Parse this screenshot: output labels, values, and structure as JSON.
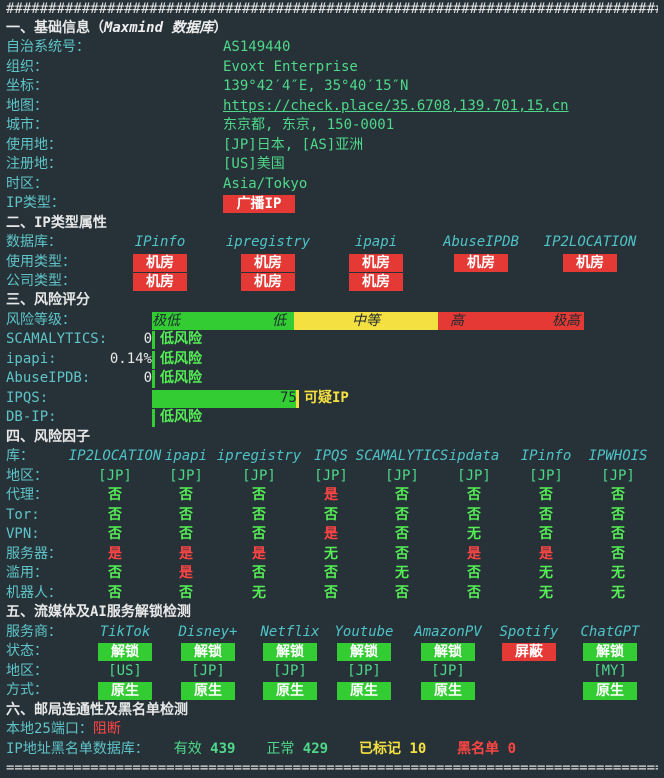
{
  "separator_top": "###############################################################################",
  "separator_bottom": "===============================================================================",
  "s1": {
    "title": "一、基础信息（",
    "title_ital": "Maxmind 数据库",
    "title_end": "）",
    "rows": [
      {
        "label": "自治系统号：",
        "value": "AS149440"
      },
      {
        "label": "组织：",
        "value": "Evoxt Enterprise"
      },
      {
        "label": "坐标：",
        "value": "139°42′4″E, 35°40′15″N"
      },
      {
        "label": "地图：",
        "value": "https://check.place/35.6708,139.701,15,cn"
      },
      {
        "label": "城市：",
        "value": "东京都, 东京, 150-0001"
      },
      {
        "label": "使用地：",
        "value": "[JP]日本, [AS]亚洲"
      },
      {
        "label": "注册地：",
        "value": "[US]美国"
      },
      {
        "label": "时区：",
        "value": "Asia/Tokyo"
      },
      {
        "label": "IP类型：",
        "value": "广播IP"
      }
    ]
  },
  "s2": {
    "title": "二、IP类型属性",
    "db_label": "数据库：",
    "usage_label": "使用类型：",
    "company_label": "公司类型：",
    "dbs": [
      "IPinfo",
      "ipregistry",
      "ipapi",
      "AbuseIPDB",
      "IP2LOCATION"
    ],
    "usage": [
      "机房",
      "机房",
      "机房",
      "机房",
      "机房"
    ],
    "company": [
      "机房",
      "机房",
      "机房"
    ]
  },
  "s3": {
    "title": "三、风险评分",
    "level_label": "风险等级：",
    "levels": [
      "极低",
      "低",
      "中等",
      "高",
      "极高"
    ],
    "rows": [
      {
        "label": "SCAMALYTICS:",
        "score": "0",
        "verdict": "低风险"
      },
      {
        "label": "ipapi:",
        "score": "0.14%",
        "verdict": "低风险"
      },
      {
        "label": "AbuseIPDB:",
        "score": "0",
        "verdict": "低风险"
      },
      {
        "label": "IPQS:",
        "score": "75",
        "verdict": "可疑IP"
      },
      {
        "label": "DB-IP:",
        "score": "",
        "verdict": "低风险"
      }
    ]
  },
  "s4": {
    "title": "四、风险因子",
    "lib_label": "库：",
    "libs": [
      "IP2LOCATION",
      "ipapi",
      "ipregistry",
      "IPQS",
      "SCAMALYTICS",
      "ipdata",
      "IPinfo",
      "IPWHOIS"
    ],
    "rows": [
      {
        "label": "地区：",
        "values": [
          "[JP]",
          "[JP]",
          "[JP]",
          "[JP]",
          "[JP]",
          "[JP]",
          "[JP]",
          "[JP]"
        ]
      },
      {
        "label": "代理：",
        "values": [
          "否",
          "否",
          "否",
          "是",
          "否",
          "否",
          "否",
          "否"
        ]
      },
      {
        "label": "Tor:",
        "values": [
          "否",
          "否",
          "否",
          "否",
          "否",
          "否",
          "否",
          "否"
        ]
      },
      {
        "label": "VPN:",
        "values": [
          "否",
          "否",
          "否",
          "是",
          "否",
          "无",
          "否",
          "否"
        ]
      },
      {
        "label": "服务器：",
        "values": [
          "是",
          "是",
          "是",
          "无",
          "否",
          "是",
          "是",
          "否"
        ]
      },
      {
        "label": "滥用：",
        "values": [
          "否",
          "是",
          "否",
          "否",
          "无",
          "否",
          "无",
          "无"
        ]
      },
      {
        "label": "机器人：",
        "values": [
          "否",
          "否",
          "无",
          "否",
          "否",
          "否",
          "无",
          "无"
        ]
      }
    ]
  },
  "s5": {
    "title": "五、流媒体及AI服务解锁检测",
    "provider_label": "服务商：",
    "status_label": "状态：",
    "region_label": "地区：",
    "method_label": "方式：",
    "providers": [
      "TikTok",
      "Disney+",
      "Netflix",
      "Youtube",
      "AmazonPV",
      "Spotify",
      "ChatGPT"
    ],
    "status": [
      "解锁",
      "解锁",
      "解锁",
      "解锁",
      "解锁",
      "屏蔽",
      "解锁"
    ],
    "regions": [
      "[US]",
      "[JP]",
      "[JP]",
      "[JP]",
      "[JP]",
      "",
      "[MY]"
    ],
    "methods": [
      "原生",
      "原生",
      "原生",
      "原生",
      "原生",
      "",
      "原生"
    ]
  },
  "s6": {
    "title": "六、邮局连通性及黑名单检测",
    "port_label": "本地25端口：",
    "port_value": "阻断",
    "bl_label": "IP地址黑名单数据库：",
    "valid_label": "有效",
    "valid_value": "439",
    "normal_label": "正常",
    "normal_value": "429",
    "marked_label": "已标记",
    "marked_value": "10",
    "black_label": "黑名单",
    "black_value": "0"
  }
}
